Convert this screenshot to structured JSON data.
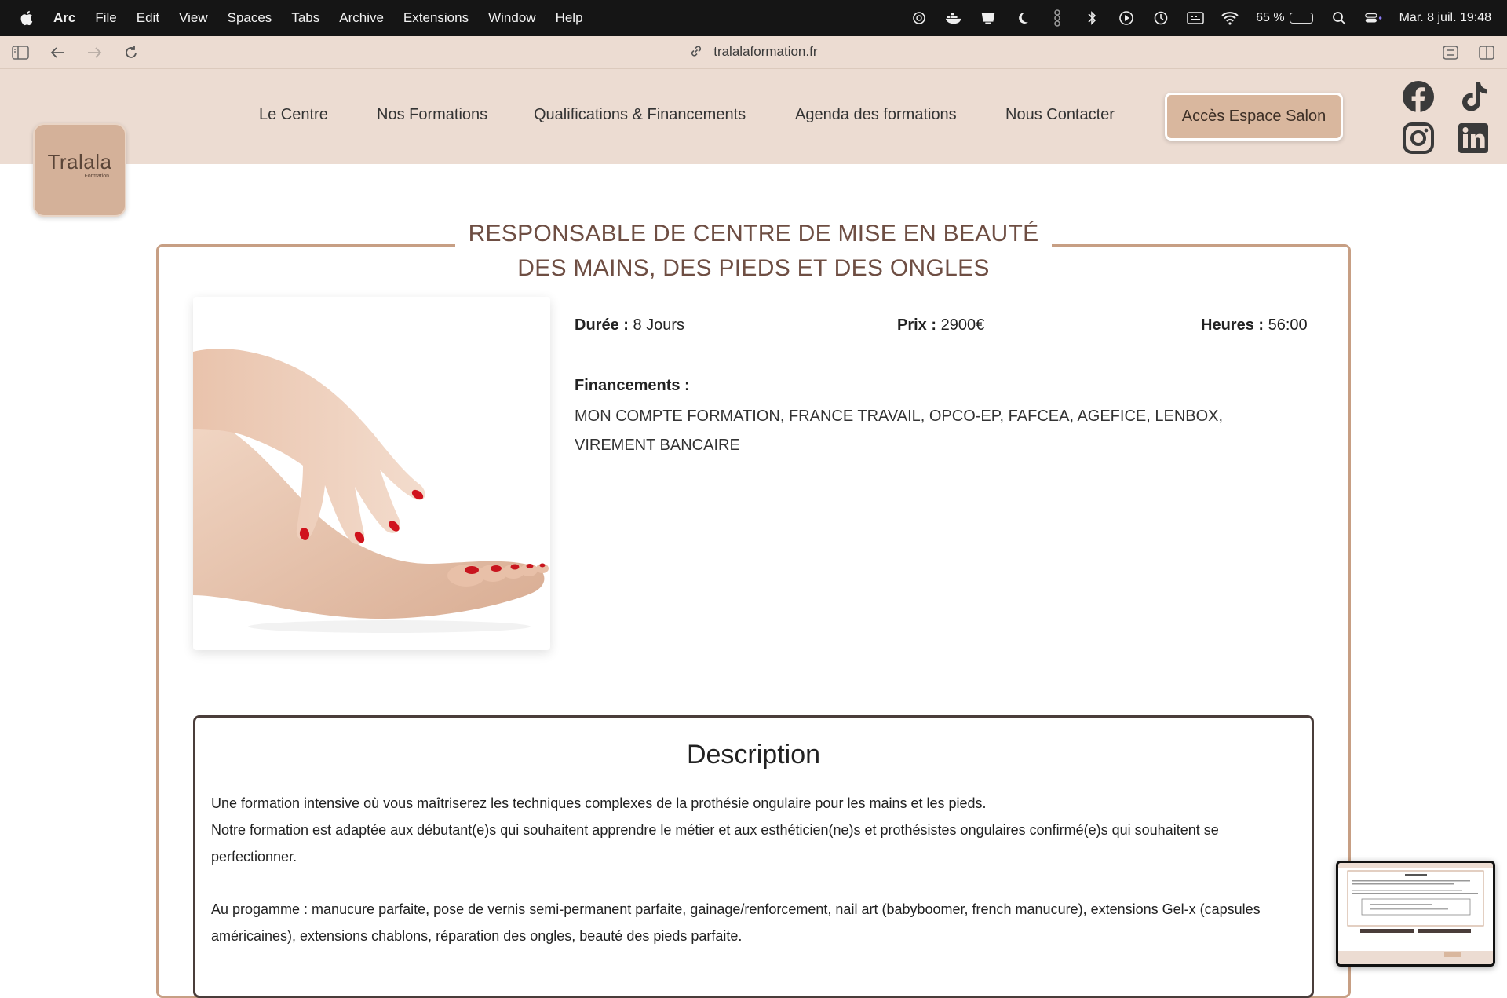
{
  "menubar": {
    "app_name": "Arc",
    "items": [
      "File",
      "Edit",
      "View",
      "Spaces",
      "Tabs",
      "Archive",
      "Extensions",
      "Window",
      "Help"
    ],
    "battery_percent": "65 %",
    "datetime": "Mar. 8 juil. 19:48"
  },
  "browser": {
    "url": "tralalaformation.fr"
  },
  "site": {
    "logo_text": "Tralala",
    "logo_sub": "Formation",
    "nav": [
      "Le Centre",
      "Nos Formations",
      "Qualifications & Financements",
      "Agenda des formations",
      "Nous Contacter"
    ],
    "cta_label": "Accès Espace Salon"
  },
  "course": {
    "title_line1": "RESPONSABLE DE CENTRE DE MISE EN BEAUTÉ",
    "title_line2": "DES MAINS, DES PIEDS ET DES ONGLES",
    "duration_label": "Durée :",
    "duration_value": "8 Jours",
    "price_label": "Prix :",
    "price_value": "2900€",
    "hours_label": "Heures :",
    "hours_value": "56:00",
    "financing_label": "Financements :",
    "financing_text": "MON COMPTE FORMATION, FRANCE TRAVAIL, OPCO-EP, FAFCEA, AGEFICE, LENBOX, VIREMENT BANCAIRE"
  },
  "description": {
    "title": "Description",
    "paragraph1_line1": "Une formation intensive où vous maîtriserez les techniques complexes de la prothésie ongulaire pour les mains et les pieds.",
    "paragraph1_line2": "Notre formation est adaptée aux débutant(e)s qui souhaitent apprendre le métier et aux esthéticien(ne)s et prothésistes ongulaires confirmé(e)s qui souhaitent se perfectionner.",
    "paragraph2": "Au progamme : manucure parfaite, pose de vernis semi-permanent parfaite, gainage/renforcement, nail art (babyboomer, french manucure), extensions Gel-x (capsules américaines), extensions chablons, réparation des ongles, beauté des pieds parfaite."
  },
  "colors": {
    "header_bg": "#ecdcd2",
    "accent": "#d9b79e",
    "card_border": "#c79f84",
    "title_color": "#6e4e43"
  }
}
